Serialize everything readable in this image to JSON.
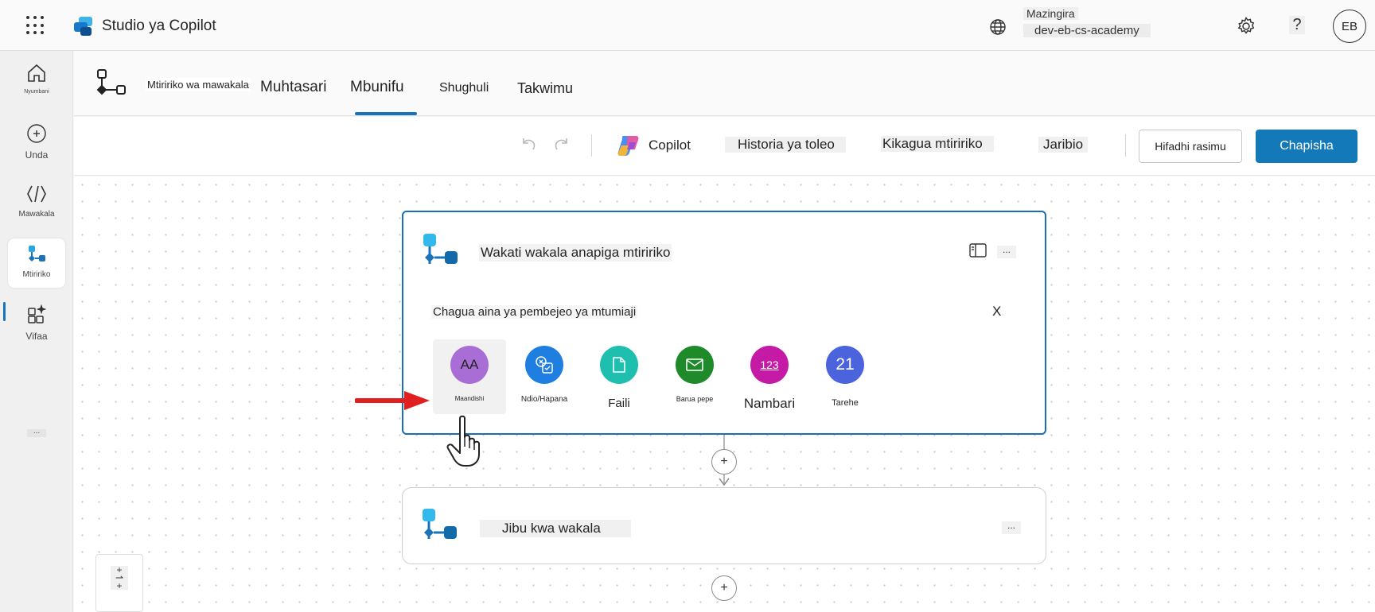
{
  "app": {
    "title": "Studio ya Copilot"
  },
  "environment": {
    "label": "Mazingira",
    "name": "dev-eb-cs-academy"
  },
  "user": {
    "initials": "EB"
  },
  "help_label": "?",
  "rail": {
    "items": [
      {
        "label": "Nyumbani",
        "icon": "home-icon"
      },
      {
        "label": "Unda",
        "icon": "create-icon"
      },
      {
        "label": "Mawakala",
        "icon": "agents-icon"
      },
      {
        "label": "Mtiririko",
        "icon": "flows-icon"
      },
      {
        "label": "Vifaa",
        "icon": "tools-icon"
      }
    ],
    "more_label": "..."
  },
  "subheader": {
    "flow_name": "Mtiririko wa mawakala",
    "tabs": [
      {
        "label": "Muhtasari"
      },
      {
        "label": "Mbunifu"
      },
      {
        "label": "Shughuli"
      },
      {
        "label": "Takwimu"
      }
    ],
    "active_tab": "Mbunifu"
  },
  "toolbar": {
    "copilot_label": "Copilot",
    "version_history_label": "Historia ya toleo",
    "flow_checker_label": "Kikagua mtiririko",
    "test_label": "Jaribio",
    "save_draft_label": "Hifadhi rasimu",
    "publish_label": "Chapisha"
  },
  "canvas": {
    "trigger_node": {
      "title": "Wakati wakala anapiga mtiririko",
      "more_label": "...",
      "prompt": "Chagua aina ya pembejeo ya mtumiaji",
      "close_label": "X",
      "input_types": [
        {
          "label": "Maandishi",
          "glyph": "AA",
          "color": "#a86ed6",
          "icon": "text-type-icon"
        },
        {
          "label": "Ndio/Hapana",
          "glyph": "",
          "color": "#1f7fe0",
          "icon": "yes-no-type-icon"
        },
        {
          "label": "Faili",
          "glyph": "",
          "color": "#1fbfb0",
          "icon": "file-type-icon"
        },
        {
          "label": "Barua pepe",
          "glyph": "",
          "color": "#1f8a2a",
          "icon": "email-type-icon"
        },
        {
          "label": "Nambari",
          "glyph": "123",
          "color": "#c41aa6",
          "icon": "number-type-icon"
        },
        {
          "label": "Tarehe",
          "glyph": "21",
          "color": "#4b63dd",
          "icon": "date-type-icon"
        }
      ],
      "selected_type": "Maandishi"
    },
    "response_node": {
      "title": "Jibu kwa wakala",
      "more_label": "..."
    },
    "add_step_label": "+"
  }
}
